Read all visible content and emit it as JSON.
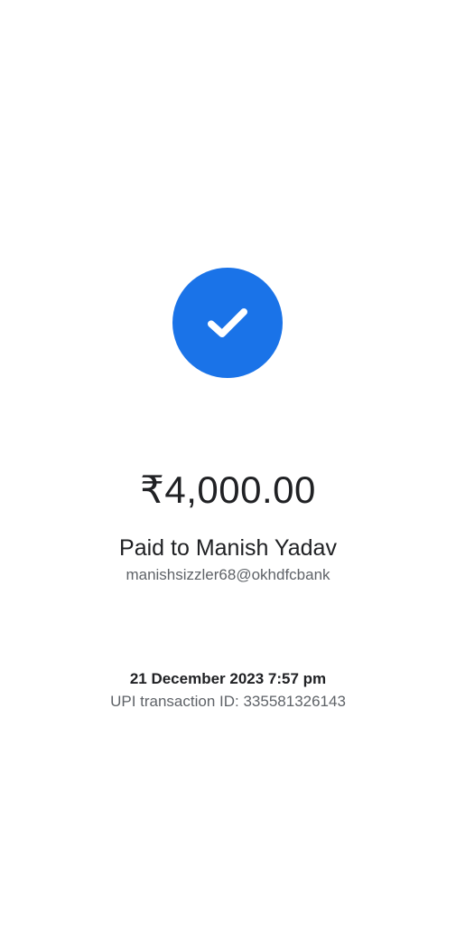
{
  "colors": {
    "accent": "#1a73e8",
    "background": "#ffffff",
    "primary_text": "#202124",
    "secondary_text": "#5f6368"
  },
  "status": {
    "icon": "check-icon"
  },
  "payment": {
    "amount": "₹4,000.00",
    "paid_to": "Paid to Manish Yadav",
    "upi_id": "manishsizzler68@okhdfcbank"
  },
  "transaction": {
    "datetime": "21 December 2023 7:57 pm",
    "upi_transaction_id": "UPI transaction ID: 335581326143"
  }
}
